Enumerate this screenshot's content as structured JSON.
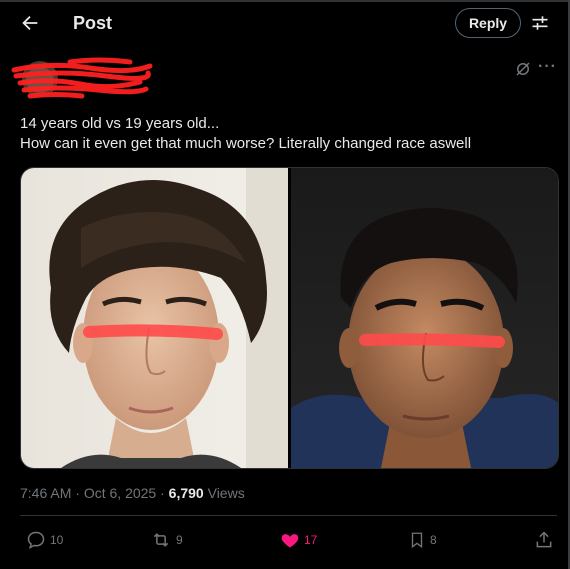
{
  "header": {
    "title": "Post",
    "reply_label": "Reply"
  },
  "post": {
    "line1": "14 years old vs 19 years old...",
    "line2": "How can it even get that much worse? Literally changed race aswell",
    "time": "7:46 AM",
    "date": "Oct 6, 2025",
    "views_count": "6,790",
    "views_label": "Views"
  },
  "actions": {
    "replies": "10",
    "reposts": "9",
    "likes": "17",
    "bookmarks": "8"
  },
  "icons": {
    "back": "back-arrow-icon",
    "tune": "sliders-icon",
    "grok": "grok-icon",
    "more": "more-icon",
    "reply": "reply-icon",
    "repost": "repost-icon",
    "like": "heart-icon",
    "bookmark": "bookmark-icon",
    "share": "share-icon"
  },
  "colors": {
    "background": "#000000",
    "text": "#e7e9ea",
    "muted": "#71767b",
    "like_active": "#f91880",
    "redaction": "#ff2020"
  }
}
